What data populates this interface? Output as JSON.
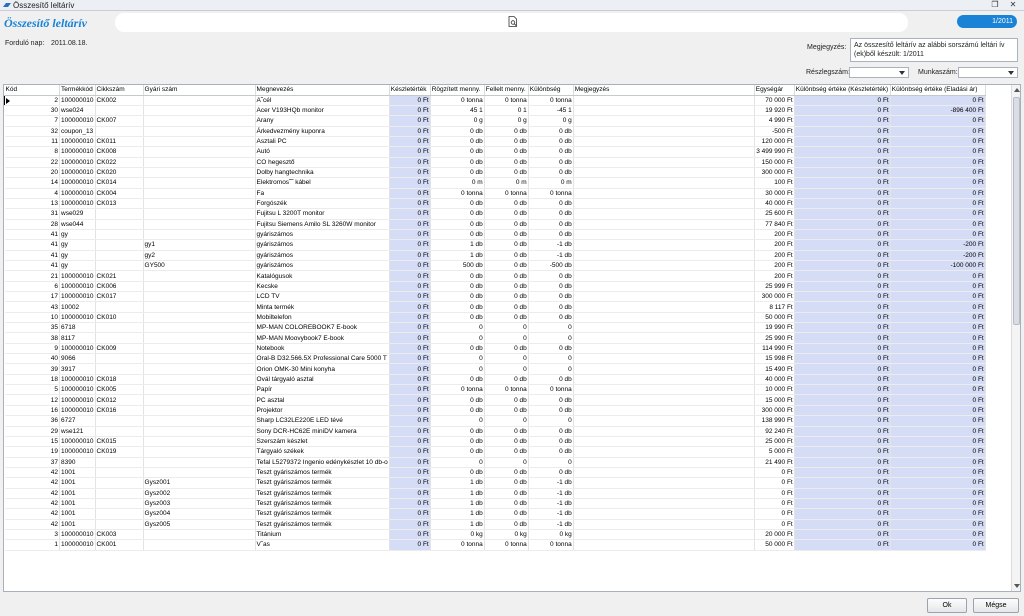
{
  "window": {
    "title": "Összesítő leltárív"
  },
  "header": {
    "form_title": "Összesítő leltárív",
    "page_badge": "1/2011"
  },
  "fields": {
    "turnover_label": "Forduló nap:",
    "turnover_value": "2011.08.18.",
    "note_label": "Megjegyzés:",
    "note_value": "Az összesítő leltárív az alábbi sorszámú leltári ív (ek)ből készült: 1/2011",
    "warehouse_label": "Részlegszám:",
    "worknum_label": "Munkaszám:"
  },
  "grid": {
    "columns": [
      "Kód",
      "Termékkód",
      "Cikkszám",
      "Gyári szám",
      "Megnevezés",
      "Készletérték",
      "Rögzített menny.",
      "Fellelt menny.",
      "Különbség",
      "Megjegyzés",
      "Egységár",
      "Különbség értéke (Készletérték)",
      "Különbség értéke (Eladási ár)"
    ],
    "rows": [
      [
        "2",
        "100000010",
        "CK002",
        "",
        "A˜cél",
        "0 Ft",
        "0 tonna",
        "0 tonna",
        "0 tonna",
        "",
        "70 000 Ft",
        "0 Ft",
        "0 Ft"
      ],
      [
        "30",
        "wse024",
        "",
        "",
        "Acer V193HQb monitor",
        "0 Ft",
        "45 1",
        "0 1",
        "-45 1",
        "",
        "19 920 Ft",
        "0 Ft",
        "-896 400 Ft"
      ],
      [
        "7",
        "100000010",
        "CK007",
        "",
        "Arany",
        "0 Ft",
        "0 g",
        "0 g",
        "0 g",
        "",
        "4 990 Ft",
        "0 Ft",
        "0 Ft"
      ],
      [
        "32",
        "coupon_13",
        "",
        "",
        "Árkedvezmény kuponra",
        "0 Ft",
        "0 db",
        "0 db",
        "0 db",
        "",
        "-500 Ft",
        "0 Ft",
        "0 Ft"
      ],
      [
        "11",
        "100000010",
        "CK011",
        "",
        "Asztali PC",
        "0 Ft",
        "0 db",
        "0 db",
        "0 db",
        "",
        "120 000 Ft",
        "0 Ft",
        "0 Ft"
      ],
      [
        "8",
        "100000010",
        "CK008",
        "",
        "Autó",
        "0 Ft",
        "0 db",
        "0 db",
        "0 db",
        "",
        "3 499 990 Ft",
        "0 Ft",
        "0 Ft"
      ],
      [
        "22",
        "100000010",
        "CK022",
        "",
        "CO hegesztő",
        "0 Ft",
        "0 db",
        "0 db",
        "0 db",
        "",
        "150 000 Ft",
        "0 Ft",
        "0 Ft"
      ],
      [
        "20",
        "100000010",
        "CK020",
        "",
        "Dolby hangtechnika",
        "0 Ft",
        "0 db",
        "0 db",
        "0 db",
        "",
        "300 000 Ft",
        "0 Ft",
        "0 Ft"
      ],
      [
        "14",
        "100000010",
        "CK014",
        "",
        "Elektromos˜˜ kábel",
        "0 Ft",
        "0 m",
        "0 m",
        "0 m",
        "",
        "100 Ft",
        "0 Ft",
        "0 Ft"
      ],
      [
        "4",
        "100000010",
        "CK004",
        "",
        "Fa",
        "0 Ft",
        "0 tonna",
        "0 tonna",
        "0 tonna",
        "",
        "30 000 Ft",
        "0 Ft",
        "0 Ft"
      ],
      [
        "13",
        "100000010",
        "CK013",
        "",
        "Forgószék",
        "0 Ft",
        "0 db",
        "0 db",
        "0 db",
        "",
        "40 000 Ft",
        "0 Ft",
        "0 Ft"
      ],
      [
        "31",
        "wse029",
        "",
        "",
        "Fujitsu L 3200T monitor",
        "0 Ft",
        "0 db",
        "0 db",
        "0 db",
        "",
        "25 600 Ft",
        "0 Ft",
        "0 Ft"
      ],
      [
        "28",
        "wse044",
        "",
        "",
        "Fujitsu Siemens Amilo SL 3260W monitor",
        "0 Ft",
        "0 db",
        "0 db",
        "0 db",
        "",
        "77 840 Ft",
        "0 Ft",
        "0 Ft"
      ],
      [
        "41",
        "gy",
        "",
        "",
        "gyáriszámos",
        "0 Ft",
        "0 db",
        "0 db",
        "0 db",
        "",
        "200 Ft",
        "0 Ft",
        "0 Ft"
      ],
      [
        "41",
        "gy",
        "",
        "gy1",
        "gyáriszámos",
        "0 Ft",
        "1 db",
        "0 db",
        "-1 db",
        "",
        "200 Ft",
        "0 Ft",
        "-200 Ft"
      ],
      [
        "41",
        "gy",
        "",
        "gy2",
        "gyáriszámos",
        "0 Ft",
        "1 db",
        "0 db",
        "-1 db",
        "",
        "200 Ft",
        "0 Ft",
        "-200 Ft"
      ],
      [
        "41",
        "gy",
        "",
        "GY500",
        "gyáriszámos",
        "0 Ft",
        "500 db",
        "0 db",
        "-500 db",
        "",
        "200 Ft",
        "0 Ft",
        "-100 000 Ft"
      ],
      [
        "21",
        "100000010",
        "CK021",
        "",
        "Katalógusok",
        "0 Ft",
        "0 db",
        "0 db",
        "0 db",
        "",
        "200 Ft",
        "0 Ft",
        "0 Ft"
      ],
      [
        "6",
        "100000010",
        "CK006",
        "",
        "Kecske",
        "0 Ft",
        "0 db",
        "0 db",
        "0 db",
        "",
        "25 999 Ft",
        "0 Ft",
        "0 Ft"
      ],
      [
        "17",
        "100000010",
        "CK017",
        "",
        "LCD TV",
        "0 Ft",
        "0 db",
        "0 db",
        "0 db",
        "",
        "300 000 Ft",
        "0 Ft",
        "0 Ft"
      ],
      [
        "43",
        "10002",
        "",
        "",
        "Minta termék",
        "0 Ft",
        "0 db",
        "0 db",
        "0 db",
        "",
        "8 117 Ft",
        "0 Ft",
        "0 Ft"
      ],
      [
        "10",
        "100000010",
        "CK010",
        "",
        "Mobiltelefon",
        "0 Ft",
        "0 db",
        "0 db",
        "0 db",
        "",
        "50 000 Ft",
        "0 Ft",
        "0 Ft"
      ],
      [
        "35",
        "6718",
        "",
        "",
        "MP-MAN COLOREBOOK7 E-book",
        "0 Ft",
        "0",
        "0",
        "0",
        "",
        "19 990 Ft",
        "0 Ft",
        "0 Ft"
      ],
      [
        "38",
        "8117",
        "",
        "",
        "MP-MAN Moovybook7 E-book",
        "0 Ft",
        "0",
        "0",
        "0",
        "",
        "25 990 Ft",
        "0 Ft",
        "0 Ft"
      ],
      [
        "9",
        "100000010",
        "CK009",
        "",
        "Notebook",
        "0 Ft",
        "0 db",
        "0 db",
        "0 db",
        "",
        "114 990 Ft",
        "0 Ft",
        "0 Ft"
      ],
      [
        "40",
        "9066",
        "",
        "",
        "Oral-B D32.566.5X Professional Care 5000 T",
        "0 Ft",
        "0",
        "0",
        "0",
        "",
        "15 998 Ft",
        "0 Ft",
        "0 Ft"
      ],
      [
        "39",
        "3917",
        "",
        "",
        "Orion OMK-30 Mini konyha",
        "0 Ft",
        "0",
        "0",
        "0",
        "",
        "15 490 Ft",
        "0 Ft",
        "0 Ft"
      ],
      [
        "18",
        "100000010",
        "CK018",
        "",
        "Ovál tárgyaló asztal",
        "0 Ft",
        "0 db",
        "0 db",
        "0 db",
        "",
        "40 000 Ft",
        "0 Ft",
        "0 Ft"
      ],
      [
        "5",
        "100000010",
        "CK005",
        "",
        "Papír",
        "0 Ft",
        "0 tonna",
        "0 tonna",
        "0 tonna",
        "",
        "10 000 Ft",
        "0 Ft",
        "0 Ft"
      ],
      [
        "12",
        "100000010",
        "CK012",
        "",
        "PC asztal",
        "0 Ft",
        "0 db",
        "0 db",
        "0 db",
        "",
        "15 000 Ft",
        "0 Ft",
        "0 Ft"
      ],
      [
        "16",
        "100000010",
        "CK016",
        "",
        "Projektor",
        "0 Ft",
        "0 db",
        "0 db",
        "0 db",
        "",
        "300 000 Ft",
        "0 Ft",
        "0 Ft"
      ],
      [
        "36",
        "6727",
        "",
        "",
        "Sharp LC32LE220E LED tévé",
        "0 Ft",
        "0",
        "0",
        "0",
        "",
        "138 990 Ft",
        "0 Ft",
        "0 Ft"
      ],
      [
        "29",
        "wse121",
        "",
        "",
        "Sony DCR-HC62E miniDV kamera",
        "0 Ft",
        "0 db",
        "0 db",
        "0 db",
        "",
        "92 240 Ft",
        "0 Ft",
        "0 Ft"
      ],
      [
        "15",
        "100000010",
        "CK015",
        "",
        "Szerszám készlet",
        "0 Ft",
        "0 db",
        "0 db",
        "0 db",
        "",
        "25 000 Ft",
        "0 Ft",
        "0 Ft"
      ],
      [
        "19",
        "100000010",
        "CK019",
        "",
        "Tárgyaló székek",
        "0 Ft",
        "0 db",
        "0 db",
        "0 db",
        "",
        "5 000 Ft",
        "0 Ft",
        "0 Ft"
      ],
      [
        "37",
        "8390",
        "",
        "",
        "Tefal L5279372 Ingenio edénykészlet  10 db-o",
        "0 Ft",
        "0",
        "0",
        "0",
        "",
        "21 490 Ft",
        "0 Ft",
        "0 Ft"
      ],
      [
        "42",
        "1001",
        "",
        "",
        "Teszt gyáriszámos termék",
        "0 Ft",
        "0 db",
        "0 db",
        "0 db",
        "",
        "0 Ft",
        "0 Ft",
        "0 Ft"
      ],
      [
        "42",
        "1001",
        "",
        "Gysz001",
        "Teszt gyáriszámos termék",
        "0 Ft",
        "1 db",
        "0 db",
        "-1 db",
        "",
        "0 Ft",
        "0 Ft",
        "0 Ft"
      ],
      [
        "42",
        "1001",
        "",
        "Gysz002",
        "Teszt gyáriszámos termék",
        "0 Ft",
        "1 db",
        "0 db",
        "-1 db",
        "",
        "0 Ft",
        "0 Ft",
        "0 Ft"
      ],
      [
        "42",
        "1001",
        "",
        "Gysz003",
        "Teszt gyáriszámos termék",
        "0 Ft",
        "1 db",
        "0 db",
        "-1 db",
        "",
        "0 Ft",
        "0 Ft",
        "0 Ft"
      ],
      [
        "42",
        "1001",
        "",
        "Gysz004",
        "Teszt gyáriszámos termék",
        "0 Ft",
        "1 db",
        "0 db",
        "-1 db",
        "",
        "0 Ft",
        "0 Ft",
        "0 Ft"
      ],
      [
        "42",
        "1001",
        "",
        "Gysz005",
        "Teszt gyáriszámos termék",
        "0 Ft",
        "1 db",
        "0 db",
        "-1 db",
        "",
        "0 Ft",
        "0 Ft",
        "0 Ft"
      ],
      [
        "3",
        "100000010",
        "CK003",
        "",
        "Titánium",
        "0 Ft",
        "0 kg",
        "0 kg",
        "0 kg",
        "",
        "20 000 Ft",
        "0 Ft",
        "0 Ft"
      ],
      [
        "1",
        "100000010",
        "CK001",
        "",
        "Vˆas",
        "0 Ft",
        "0 tonna",
        "0 tonna",
        "0 tonna",
        "",
        "50 000 Ft",
        "0 Ft",
        "0 Ft"
      ]
    ]
  },
  "footer": {
    "ok_label": "Ok",
    "cancel_label": "Mégse"
  }
}
